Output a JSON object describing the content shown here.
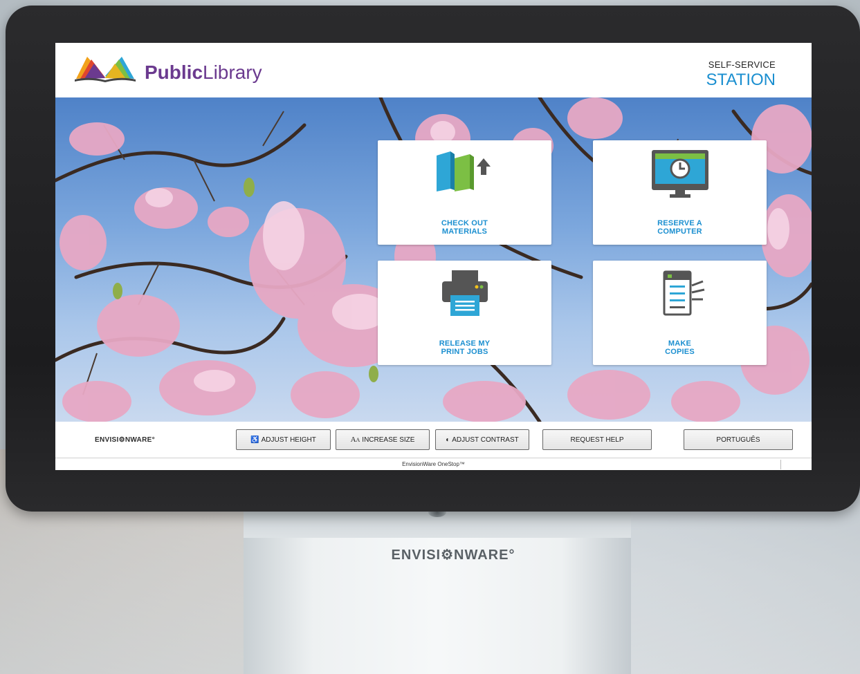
{
  "header": {
    "brand_bold": "Public",
    "brand_rest": "Library",
    "station_top": "SELF-SERVICE",
    "station_main": "STATION"
  },
  "tiles": [
    {
      "line1": "CHECK OUT",
      "line2": "MATERIALS",
      "icon": "books-checkout-icon"
    },
    {
      "line1": "RESERVE A",
      "line2": "COMPUTER",
      "icon": "computer-clock-icon"
    },
    {
      "line1": "RELEASE MY",
      "line2": "PRINT JOBS",
      "icon": "printer-icon"
    },
    {
      "line1": "MAKE",
      "line2": "COPIES",
      "icon": "copier-icon"
    }
  ],
  "toolbar": {
    "vendor_logo": "ENVISI⚙NWARE°",
    "adjust_height": "ADJUST HEIGHT",
    "increase_size": "INCREASE SIZE",
    "adjust_contrast": "ADJUST CONTRAST",
    "request_help": "REQUEST HELP",
    "language": "PORTUGUÊS"
  },
  "status_bar": {
    "text": "EnvisionWare OneStop™"
  },
  "stand": {
    "logo": "ENVISI⚙NWARE°"
  },
  "colors": {
    "accent": "#1b8fd0",
    "brand": "#6b3a8f"
  }
}
